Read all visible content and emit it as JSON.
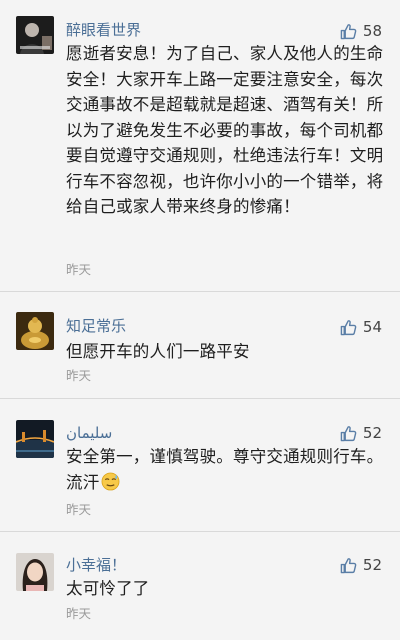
{
  "comments": [
    {
      "username": "醉眼看世界",
      "likes": "58",
      "text": "愿逝者安息！为了自己、家人及他人的生命安全！大家开车上路一定要注意安全，每次交通事故不是超载就是超速、酒驾有关！所以为了避免发生不必要的事故，每个司机都要自觉遵守交通规则，杜绝违法行车！文明行车不容忽视，也许你小小的一个错举，将给自己或家人带来终身的惨痛！",
      "time": "昨天",
      "avatar_icon": "dark-portrait-avatar"
    },
    {
      "username": "知足常乐",
      "likes": "54",
      "text": "但愿开车的人们一路平安",
      "time": "昨天",
      "avatar_icon": "golden-buddha-avatar"
    },
    {
      "username": "سليمان",
      "likes": "52",
      "text": "安全第一，谨慎驾驶。尊守交通规则行车。流汗",
      "time": "昨天",
      "avatar_icon": "night-city-avatar",
      "emoji_icon": "sweat-emoji"
    },
    {
      "username": "小幸福！",
      "likes": "52",
      "text": "太可怜了了",
      "time": "昨天",
      "avatar_icon": "girl-portrait-avatar"
    }
  ],
  "colors": {
    "username": "#4b6f96",
    "like_icon": "#5a7ea6",
    "timestamp": "#9a9a9a",
    "background": "#f4f4f4"
  }
}
